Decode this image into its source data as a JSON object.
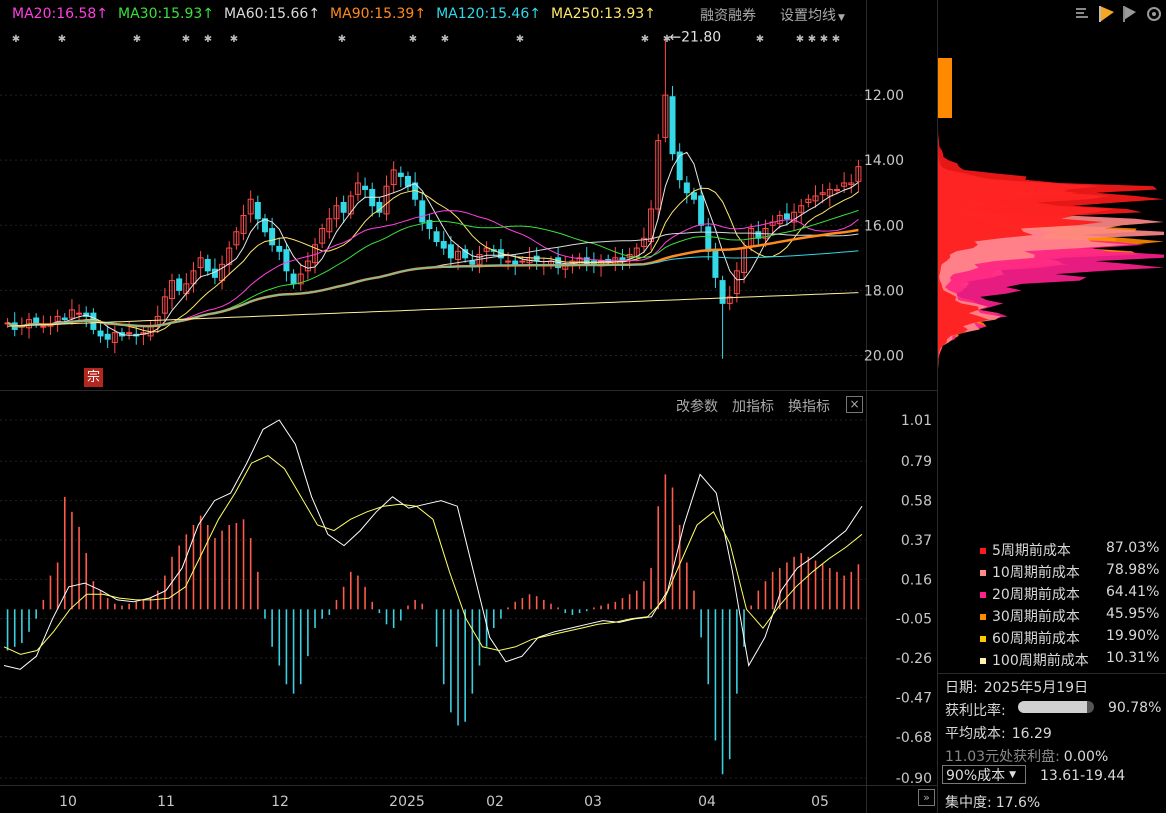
{
  "ma_legend": [
    {
      "label": "MA20:16.58",
      "arrow": "↑",
      "color": "#ff3fe0"
    },
    {
      "label": "MA30:15.93",
      "arrow": "↑",
      "color": "#3be03b"
    },
    {
      "label": "MA60:15.66",
      "arrow": "↑",
      "color": "#d9d9d9"
    },
    {
      "label": "MA90:15.39",
      "arrow": "↑",
      "color": "#ff8a1f"
    },
    {
      "label": "MA120:15.46",
      "arrow": "↑",
      "color": "#2fd9e8"
    },
    {
      "label": "MA250:13.93",
      "arrow": "↑",
      "color": "#ffe76a"
    }
  ],
  "toolbar": {
    "margin_label": "融资融券",
    "ma_setting_label": "设置均线"
  },
  "panel_buttons": {
    "params": "改参数",
    "add": "加指标",
    "switch": "换指标",
    "close": "×"
  },
  "marker_label": "宗",
  "peak_label": "←21.80",
  "expand_label": "»",
  "x_axis_labels": [
    "10",
    "11",
    "12",
    "2025",
    "02",
    "03",
    "04",
    "05"
  ],
  "price_axis_labels": [
    "20.00",
    "18.00",
    "16.00",
    "14.00",
    "12.00"
  ],
  "macd_axis_labels": [
    "1.01",
    "0.79",
    "0.58",
    "0.37",
    "0.16",
    "-0.05",
    "-0.26",
    "-0.47",
    "-0.68",
    "-0.90"
  ],
  "cost_legend": [
    {
      "label": "5周期前成本",
      "pct": "87.03%",
      "color": "#ff1a1a"
    },
    {
      "label": "10周期前成本",
      "pct": "78.98%",
      "color": "#ff8a8a"
    },
    {
      "label": "20周期前成本",
      "pct": "64.41%",
      "color": "#ff1f8f"
    },
    {
      "label": "30周期前成本",
      "pct": "45.95%",
      "color": "#ff8a00"
    },
    {
      "label": "60周期前成本",
      "pct": "19.90%",
      "color": "#ffc800"
    },
    {
      "label": "100周期前成本",
      "pct": "10.31%",
      "color": "#fff2a8"
    }
  ],
  "info": {
    "date_label": "日期:",
    "date_value": "2025年5月19日",
    "profit_label": "获利比率:",
    "profit_value": "90.78%",
    "profit_ratio": 0.9078,
    "avg_label": "平均成本:",
    "avg_value": "16.29",
    "profit_at_label": "11.03元处获利盘:",
    "profit_at_value": "0.00%",
    "cost_select": "90%成本",
    "cost_range": "13.61-19.44",
    "concentration_label": "集中度:",
    "concentration_value": "17.6%"
  },
  "colors": {
    "up": "#ff4a4a",
    "down": "#34d8e6",
    "dif": "#ffffff",
    "dea": "#ffff66",
    "macd_pos": "#ff5a4a",
    "macd_neg": "#3ad0e0"
  },
  "chart_data": [
    {
      "type": "candlestick",
      "title": "",
      "x_labels": [
        "10",
        "11",
        "12",
        "2025",
        "02",
        "03",
        "04",
        "05"
      ],
      "ylim": [
        11,
        22
      ],
      "y_ticks": [
        12,
        14,
        16,
        18,
        20
      ],
      "peak_annotation": 21.8,
      "closes": [
        13.0,
        12.8,
        12.9,
        13.1,
        13.0,
        12.9,
        12.95,
        13.2,
        13.1,
        13.4,
        13.3,
        13.2,
        12.8,
        12.6,
        12.5,
        12.7,
        12.6,
        12.7,
        12.6,
        12.7,
        12.9,
        13.2,
        13.8,
        14.3,
        14.0,
        14.2,
        14.6,
        15.0,
        14.6,
        14.4,
        14.8,
        15.3,
        15.8,
        16.3,
        16.8,
        16.2,
        15.8,
        15.4,
        15.2,
        14.6,
        14.2,
        14.5,
        14.9,
        15.4,
        15.9,
        16.2,
        16.6,
        16.4,
        16.9,
        17.3,
        17.1,
        16.6,
        16.4,
        17.2,
        17.7,
        17.5,
        17.2,
        16.8,
        16.1,
        15.9,
        15.5,
        15.3,
        15.0,
        15.2,
        15.0,
        14.8,
        15.1,
        15.3,
        15.2,
        15.0,
        14.9,
        14.8,
        14.9,
        15.0,
        14.9,
        14.8,
        14.9,
        14.7,
        14.8,
        14.9,
        15.0,
        14.8,
        14.8,
        14.9,
        14.9,
        15.0,
        14.9,
        15.1,
        15.3,
        15.6,
        16.5,
        18.6,
        20.0,
        18.2,
        17.4,
        17.0,
        16.8,
        16.0,
        15.2,
        14.4,
        13.6,
        13.8,
        14.6,
        15.3,
        15.9,
        15.6,
        15.9,
        16.1,
        16.3,
        16.2,
        16.4,
        16.6,
        16.8,
        16.9,
        17.0,
        17.1,
        17.1,
        17.3,
        17.3,
        17.8
      ],
      "series": [
        {
          "name": "MA20",
          "values": [
            16.58
          ]
        },
        {
          "name": "MA30",
          "values": [
            15.93
          ]
        },
        {
          "name": "MA60",
          "values": [
            15.66
          ]
        },
        {
          "name": "MA90",
          "values": [
            15.39
          ]
        },
        {
          "name": "MA120",
          "values": [
            15.46
          ]
        },
        {
          "name": "MA250",
          "values": [
            13.93
          ]
        }
      ]
    },
    {
      "type": "bar",
      "title": "",
      "ylim": [
        -0.9,
        1.01
      ],
      "y_ticks": [
        1.01,
        0.79,
        0.58,
        0.37,
        0.16,
        -0.05,
        -0.26,
        -0.47,
        -0.68,
        -0.9
      ],
      "macd": [
        -0.22,
        -0.2,
        -0.18,
        -0.12,
        -0.05,
        0.05,
        0.18,
        0.25,
        0.6,
        0.52,
        0.44,
        0.3,
        0.15,
        0.1,
        0.06,
        0.03,
        0.02,
        0.03,
        0.04,
        0.05,
        0.06,
        0.1,
        0.18,
        0.28,
        0.34,
        0.4,
        0.45,
        0.5,
        0.45,
        0.38,
        0.42,
        0.45,
        0.46,
        0.48,
        0.38,
        0.2,
        -0.05,
        -0.2,
        -0.3,
        -0.4,
        -0.45,
        -0.4,
        -0.25,
        -0.1,
        -0.05,
        -0.03,
        0.05,
        0.12,
        0.2,
        0.18,
        0.12,
        0.04,
        -0.02,
        -0.08,
        -0.1,
        -0.06,
        0.02,
        0.05,
        0.03,
        0.0,
        -0.2,
        -0.4,
        -0.55,
        -0.62,
        -0.6,
        -0.45,
        -0.3,
        -0.2,
        -0.1,
        -0.05,
        0.01,
        0.04,
        0.06,
        0.08,
        0.07,
        0.05,
        0.03,
        0.01,
        -0.02,
        -0.03,
        -0.02,
        -0.01,
        0.01,
        0.02,
        0.03,
        0.04,
        0.06,
        0.08,
        0.1,
        0.15,
        0.22,
        0.55,
        0.72,
        0.65,
        0.45,
        0.25,
        0.1,
        -0.15,
        -0.4,
        -0.7,
        -0.88,
        -0.8,
        -0.45,
        -0.2,
        0.02,
        0.1,
        0.15,
        0.2,
        0.22,
        0.25,
        0.28,
        0.3,
        0.28,
        0.26,
        0.24,
        0.22,
        0.2,
        0.18,
        0.2,
        0.24
      ],
      "series": [
        {
          "name": "DIF",
          "values": [
            -0.3,
            -0.32,
            -0.25,
            -0.05,
            0.12,
            0.14,
            0.1,
            0.05,
            0.04,
            0.06,
            0.1,
            0.22,
            0.45,
            0.58,
            0.62,
            0.78,
            0.96,
            1.01,
            0.88,
            0.6,
            0.4,
            0.34,
            0.42,
            0.52,
            0.6,
            0.54,
            0.56,
            0.58,
            0.55,
            0.2,
            -0.15,
            -0.28,
            -0.25,
            -0.15,
            -0.12,
            -0.1,
            -0.08,
            -0.06,
            -0.07,
            -0.05,
            -0.04,
            0.1,
            0.45,
            0.72,
            0.62,
            0.2,
            -0.3,
            -0.15,
            0.1,
            0.22,
            0.28,
            0.35,
            0.42,
            0.55
          ]
        },
        {
          "name": "DEA",
          "values": [
            -0.2,
            -0.24,
            -0.22,
            -0.12,
            0.0,
            0.08,
            0.08,
            0.06,
            0.05,
            0.05,
            0.06,
            0.12,
            0.3,
            0.48,
            0.62,
            0.78,
            0.82,
            0.75,
            0.6,
            0.45,
            0.42,
            0.48,
            0.52,
            0.55,
            0.56,
            0.55,
            0.48,
            0.2,
            -0.05,
            -0.2,
            -0.22,
            -0.2,
            -0.16,
            -0.14,
            -0.12,
            -0.1,
            -0.08,
            -0.07,
            -0.05,
            -0.04,
            0.05,
            0.25,
            0.45,
            0.52,
            0.35,
            0.0,
            -0.1,
            0.02,
            0.12,
            0.2,
            0.27,
            0.33,
            0.4
          ]
        }
      ]
    }
  ]
}
